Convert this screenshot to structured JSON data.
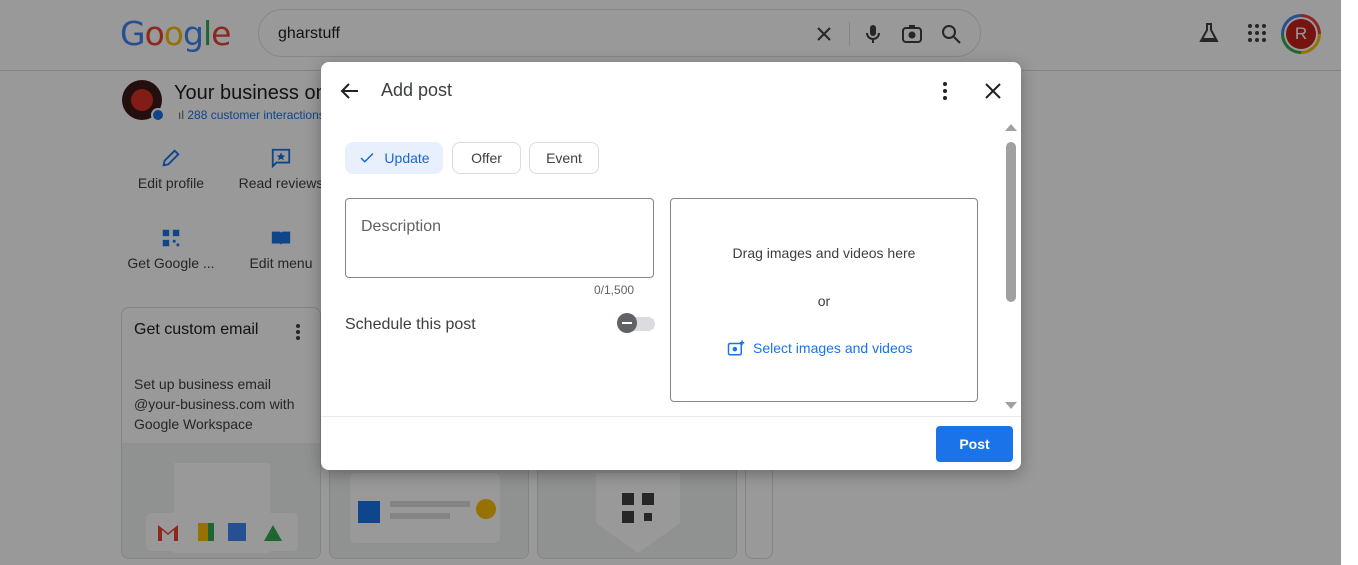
{
  "browser": {
    "logo_text": "Google",
    "search_query": "gharstuff",
    "avatar_initial": "R"
  },
  "business": {
    "title": "Your business on",
    "interactions": "288 customer interactions"
  },
  "actions": [
    {
      "label": "Edit profile",
      "icon": "pencil-icon"
    },
    {
      "label": "Read reviews",
      "icon": "star-comment-icon"
    },
    {
      "label": "Get Google ...",
      "icon": "qr-code-icon"
    },
    {
      "label": "Edit menu",
      "icon": "book-icon"
    }
  ],
  "cards": [
    {
      "title": "Get custom email",
      "text": "Set up business email @your-business.com with Google Workspace"
    }
  ],
  "dialog": {
    "title": "Add post",
    "chips": [
      {
        "label": "Update",
        "selected": true
      },
      {
        "label": "Offer",
        "selected": false
      },
      {
        "label": "Event",
        "selected": false
      }
    ],
    "description_placeholder": "Description",
    "counter": "0/1,500",
    "schedule_label": "Schedule this post",
    "schedule_enabled": false,
    "drop_text": "Drag images and videos here",
    "drop_or": "or",
    "select_link": "Select images and videos",
    "post_button": "Post"
  },
  "colors": {
    "accent": "#1a73e8",
    "chip_selected_bg": "#e8f0fe",
    "scrim": "rgba(0,0,0,0.4)"
  }
}
